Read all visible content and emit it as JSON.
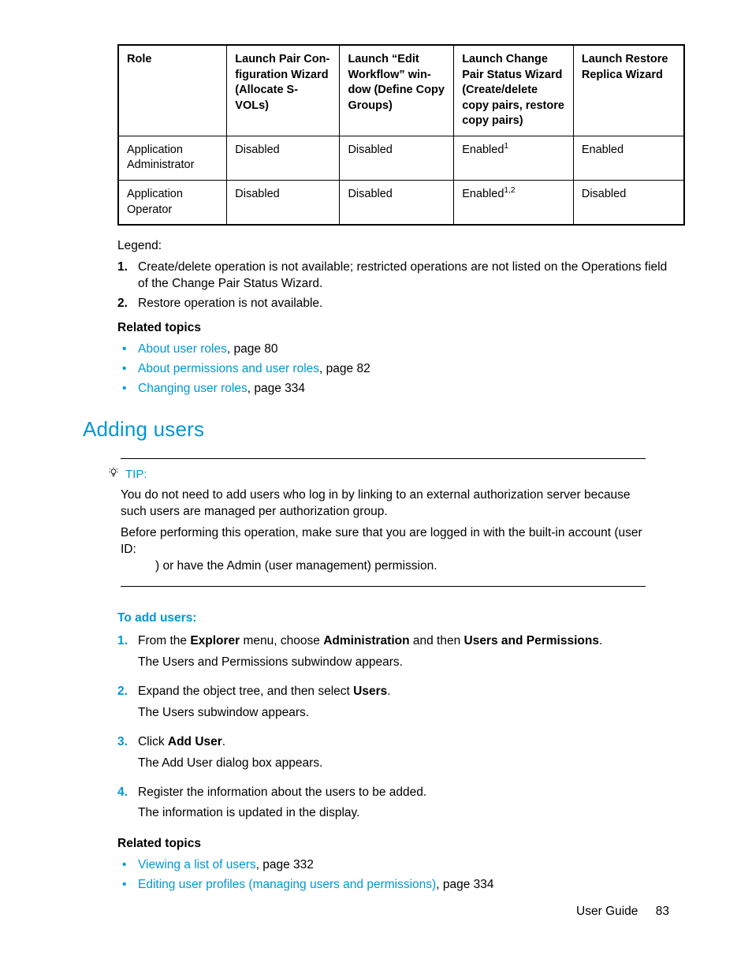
{
  "table": {
    "headers": [
      "Role",
      "Launch Pair Con­figuration Wizard (Allocate S-VOLs)",
      "Launch “Edit Workflow” win­dow (Define Copy Groups)",
      "Launch Change Pair Status Wiz­ard (Create/delete copy pairs, re­store copy pairs)",
      "Launch Restore Replica Wizard"
    ],
    "rows": [
      {
        "role": "Application Adminis­trator",
        "c1": "Disabled",
        "c2": "Disabled",
        "c3": "Enabled",
        "c3_sup": "1",
        "c4": "Enabled"
      },
      {
        "role": "Application Operator",
        "c1": "Disabled",
        "c2": "Disabled",
        "c3": "Enabled",
        "c3_sup": "1,2",
        "c4": "Disabled"
      }
    ]
  },
  "legend": {
    "label": "Legend:",
    "items": [
      {
        "num": "1.",
        "text": "Create/delete operation is not available; restricted operations are not listed on the Operations field of the Change Pair Status Wizard."
      },
      {
        "num": "2.",
        "text": "Restore operation is not available."
      }
    ]
  },
  "related1": {
    "head": "Related topics",
    "items": [
      {
        "link": "About user roles",
        "suffix": ", page 80"
      },
      {
        "link": "About permissions and user roles",
        "suffix": ", page 82"
      },
      {
        "link": "Changing user roles",
        "suffix": ", page 334"
      }
    ]
  },
  "section_title": "Adding users",
  "tip": {
    "label": "TIP:",
    "p1": "You do not need to add users who log in by linking to an external authorization server because such users are managed per authorization group.",
    "p2a": "Before performing this operation, make sure that you are logged in with the built-in account (user ID:",
    "p2b": ") or have the Admin (user management) permission."
  },
  "procedure": {
    "head": "To add users:",
    "steps": [
      {
        "num": "1.",
        "pre": "From the ",
        "b1": "Explorer",
        "mid1": " menu, choose ",
        "b2": "Administration",
        "mid2": " and then ",
        "b3": "Users and Permissions",
        "post": ".",
        "after": "The Users and Permissions subwindow appears."
      },
      {
        "num": "2.",
        "pre": "Expand the object tree, and then select ",
        "b1": "Users",
        "post": ".",
        "after": "The Users subwindow appears."
      },
      {
        "num": "3.",
        "pre": "Click ",
        "b1": "Add User",
        "post": ".",
        "after": "The Add User dialog box appears."
      },
      {
        "num": "4.",
        "plain": "Register the information about the users to be added.",
        "after": "The information is updated in the display."
      }
    ]
  },
  "related2": {
    "head": "Related topics",
    "items": [
      {
        "link": "Viewing a list of users",
        "suffix": ", page 332"
      },
      {
        "link": "Editing user profiles (managing users and permissions)",
        "suffix": ", page 334"
      }
    ]
  },
  "footer": {
    "label": "User Guide",
    "page": "83"
  }
}
